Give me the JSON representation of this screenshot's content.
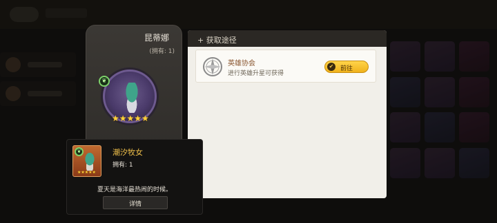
{
  "hero": {
    "name": "昆蒂娜",
    "owned": "(拥有: 1)",
    "stars": "★★★★★",
    "element_icon": "leaf-element-icon"
  },
  "sources": {
    "title": "+ 获取途径",
    "items": [
      {
        "name": "英雄协会",
        "desc": "进行英雄升星可获得",
        "button": "前往",
        "icon": "compass-icon"
      }
    ]
  },
  "tooltip": {
    "name": "潮汐牧女",
    "owned": "拥有: 1",
    "stars": "★★★★★",
    "description": "夏天是海洋最热闹的时候。",
    "detail_button": "详情"
  },
  "colors": {
    "accent_gold": "#f0b21c",
    "item_name": "#f0c04a",
    "source_name": "#8a5630",
    "panel_bg": "#f1efe9"
  }
}
